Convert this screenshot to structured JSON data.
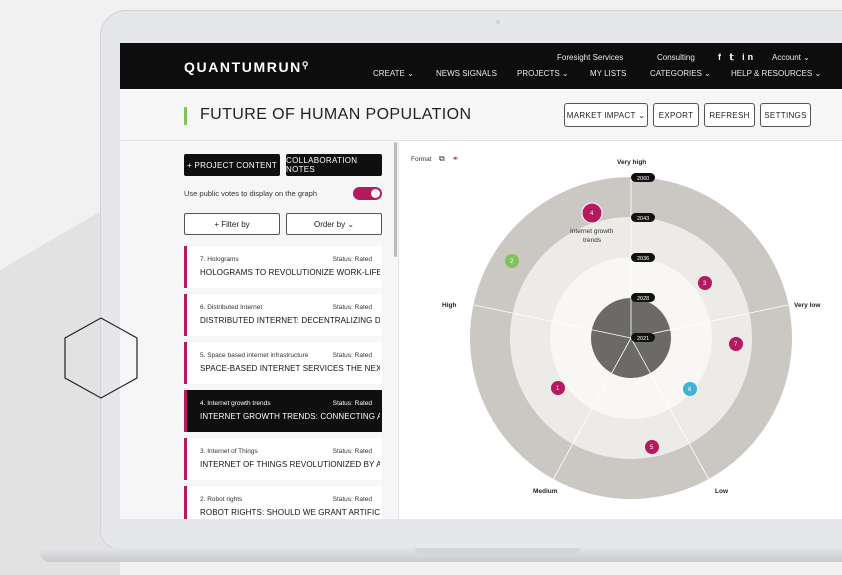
{
  "nav": {
    "logo": "QUANTUMRUN",
    "top_links": [
      "Foresight Services",
      "Consulting",
      "Account"
    ],
    "bottom_links": [
      "CREATE",
      "NEWS SIGNALS",
      "PROJECTS",
      "MY LISTS",
      "CATEGORIES",
      "HELP & RESOURCES"
    ],
    "social": "f 𝕥 in"
  },
  "header": {
    "title": "FUTURE OF HUMAN POPULATION",
    "buttons": {
      "market_impact": "MARKET IMPACT",
      "export": "EXPORT",
      "refresh": "REFRESH",
      "settings": "SETTINGS"
    }
  },
  "sidebar": {
    "project_content": "+ PROJECT CONTENT",
    "collaboration_notes": "COLLABORATION NOTES",
    "votes_label": "Use public votes to display on the graph",
    "votes_toggle_on": true,
    "filter_by": "+ Filter by",
    "order_by": "Order by",
    "cards": [
      {
        "index": "7. Holograms",
        "status": "Status: Rated",
        "title": "HOLOGRAMS TO REVOLUTIONIZE WORK-LIFE..."
      },
      {
        "index": "6. Distributed Internet",
        "status": "Status: Rated",
        "title": "DISTRIBUTED INTERNET: DECENTRALIZING DATA..."
      },
      {
        "index": "5. Space based internet infrastructure",
        "status": "Status: Rated",
        "title": "SPACE-BASED INTERNET SERVICES THE NEXT..."
      },
      {
        "index": "4. Internet growth trends",
        "status": "Status: Rated",
        "title": "INTERNET GROWTH TRENDS: CONNECTING AN..."
      },
      {
        "index": "3. Internet of Things",
        "status": "Status: Rated",
        "title": "INTERNET OF THINGS REVOLUTIONIZED BY AI: THE..."
      },
      {
        "index": "2. Robot rights",
        "status": "Status: Rated",
        "title": "ROBOT RIGHTS: SHOULD WE GRANT ARTIFICIAL..."
      }
    ]
  },
  "chart": {
    "format_label": "Format",
    "axis_labels": {
      "top": "Very high",
      "left": "High",
      "right": "Very low",
      "bottom_left": "Medium",
      "bottom_right": "Low"
    },
    "year_labels": [
      "2060",
      "2043",
      "2036",
      "2028",
      "2021"
    ],
    "points": [
      {
        "label": "1",
        "color": "#b5195e"
      },
      {
        "label": "2",
        "color": "#7fc35a"
      },
      {
        "label": "3",
        "color": "#b5195e"
      },
      {
        "label": "4",
        "color": "#b5195e",
        "note_line1": "Internet growth",
        "note_line2": "trends"
      },
      {
        "label": "5",
        "color": "#b5195e"
      },
      {
        "label": "6",
        "color": "#3fb2d6"
      },
      {
        "label": "7",
        "color": "#b5195e"
      }
    ]
  }
}
